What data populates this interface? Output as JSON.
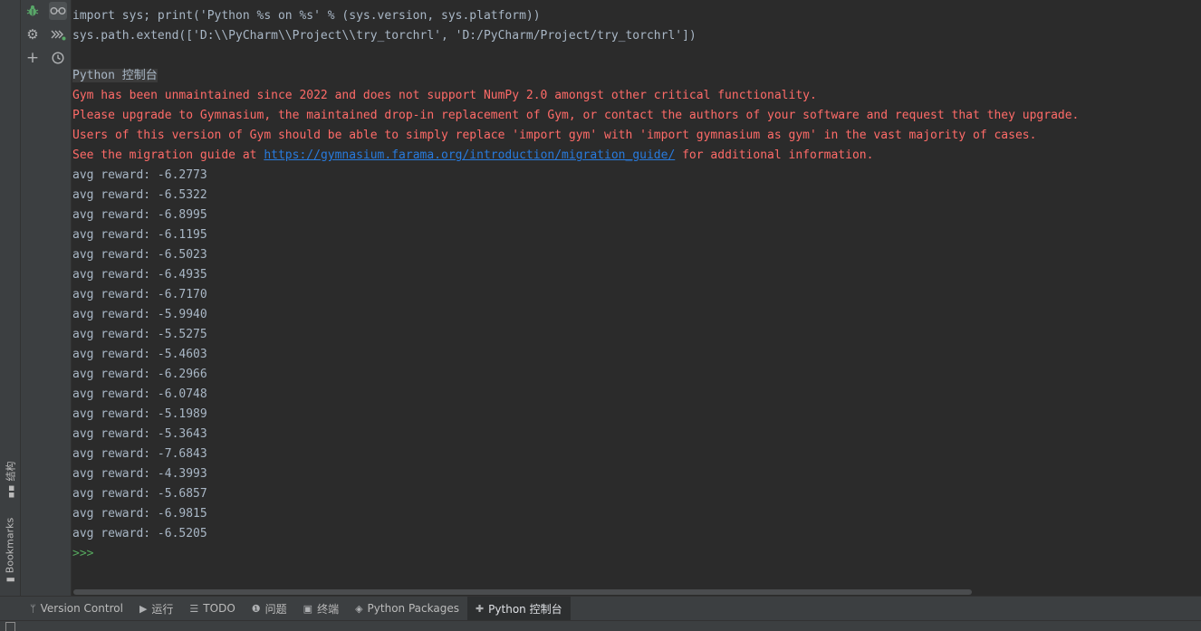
{
  "left_strip": {
    "structure_label": "结构",
    "bookmarks_label": "Bookmarks"
  },
  "toolbar": {
    "icons": [
      "bug-icon",
      "glasses-icon",
      "gear-icon",
      "run-all-icon",
      "plus-icon",
      "history-icon"
    ]
  },
  "console": {
    "lines": [
      "import sys; print('Python %s on %s' % (sys.version, sys.platform))",
      "sys.path.extend(['D:\\\\PyCharm\\\\Project\\\\try_torchrl', 'D:/PyCharm/Project/try_torchrl'])"
    ],
    "banner": "Python 控制台",
    "warnings": [
      "Gym has been unmaintained since 2022 and does not support NumPy 2.0 amongst other critical functionality.",
      "Please upgrade to Gymnasium, the maintained drop-in replacement of Gym, or contact the authors of your software and request that they upgrade.",
      "Users of this version of Gym should be able to simply replace 'import gym' with 'import gymnasium as gym' in the vast majority of cases."
    ],
    "migration": {
      "prefix": "See the migration guide at ",
      "link": "https://gymnasium.farama.org/introduction/migration_guide/",
      "suffix": " for additional information."
    },
    "rewards": [
      "avg reward: -6.2773",
      "avg reward: -6.5322",
      "avg reward: -6.8995",
      "avg reward: -6.1195",
      "avg reward: -6.5023",
      "avg reward: -6.4935",
      "avg reward: -6.7170",
      "avg reward: -5.9940",
      "avg reward: -5.5275",
      "avg reward: -5.4603",
      "avg reward: -6.2966",
      "avg reward: -6.0748",
      "avg reward: -5.1989",
      "avg reward: -5.3643",
      "avg reward: -7.6843",
      "avg reward: -4.3993",
      "avg reward: -5.6857",
      "avg reward: -6.9815",
      "avg reward: -6.5205"
    ],
    "prompt": ">>>"
  },
  "bottom_tabs": [
    {
      "label": "Version Control",
      "icon": "branch-icon"
    },
    {
      "label": "运行",
      "icon": "run-icon"
    },
    {
      "label": "TODO",
      "icon": "list-icon"
    },
    {
      "label": "问题",
      "icon": "problems-icon"
    },
    {
      "label": "终端",
      "icon": "terminal-icon"
    },
    {
      "label": "Python Packages",
      "icon": "layers-icon"
    },
    {
      "label": "Python 控制台",
      "icon": "python-icon",
      "active": true
    }
  ]
}
